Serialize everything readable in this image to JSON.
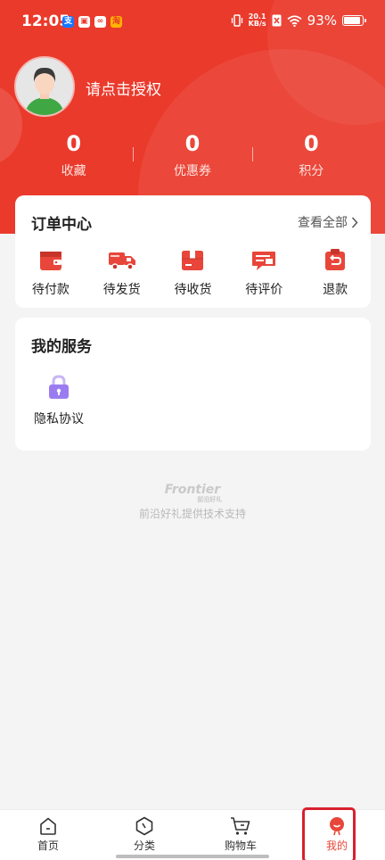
{
  "status_bar": {
    "time": "12:05",
    "net_speed_value": "20.1",
    "net_speed_unit": "KB/s",
    "battery_text": "93%",
    "battery_level": 0.93
  },
  "profile": {
    "login_prompt": "请点击授权"
  },
  "stats": [
    {
      "value": "0",
      "label": "收藏"
    },
    {
      "value": "0",
      "label": "优惠券"
    },
    {
      "value": "0",
      "label": "积分"
    }
  ],
  "orders": {
    "title": "订单中心",
    "view_all": "查看全部",
    "items": [
      {
        "label": "待付款",
        "icon": "wallet-icon"
      },
      {
        "label": "待发货",
        "icon": "truck-icon"
      },
      {
        "label": "待收货",
        "icon": "box-icon"
      },
      {
        "label": "待评价",
        "icon": "review-icon"
      },
      {
        "label": "退款",
        "icon": "refund-icon"
      }
    ]
  },
  "services": {
    "title": "我的服务",
    "items": [
      {
        "label": "隐私协议",
        "icon": "lock-icon"
      }
    ]
  },
  "footer": {
    "brand": "Frontier",
    "brand_cn": "前沿好礼",
    "support": "前沿好礼提供技术支持"
  },
  "tabbar": {
    "items": [
      {
        "label": "首页",
        "icon": "home-icon"
      },
      {
        "label": "分类",
        "icon": "category-icon"
      },
      {
        "label": "购物车",
        "icon": "cart-icon"
      },
      {
        "label": "我的",
        "icon": "profile-icon",
        "active": true
      }
    ]
  },
  "colors": {
    "brand_red": "#ea3a2c",
    "active_tab": "#e8463a",
    "highlight_border": "#d8202f",
    "lock_purple": "#9b7cf0"
  }
}
